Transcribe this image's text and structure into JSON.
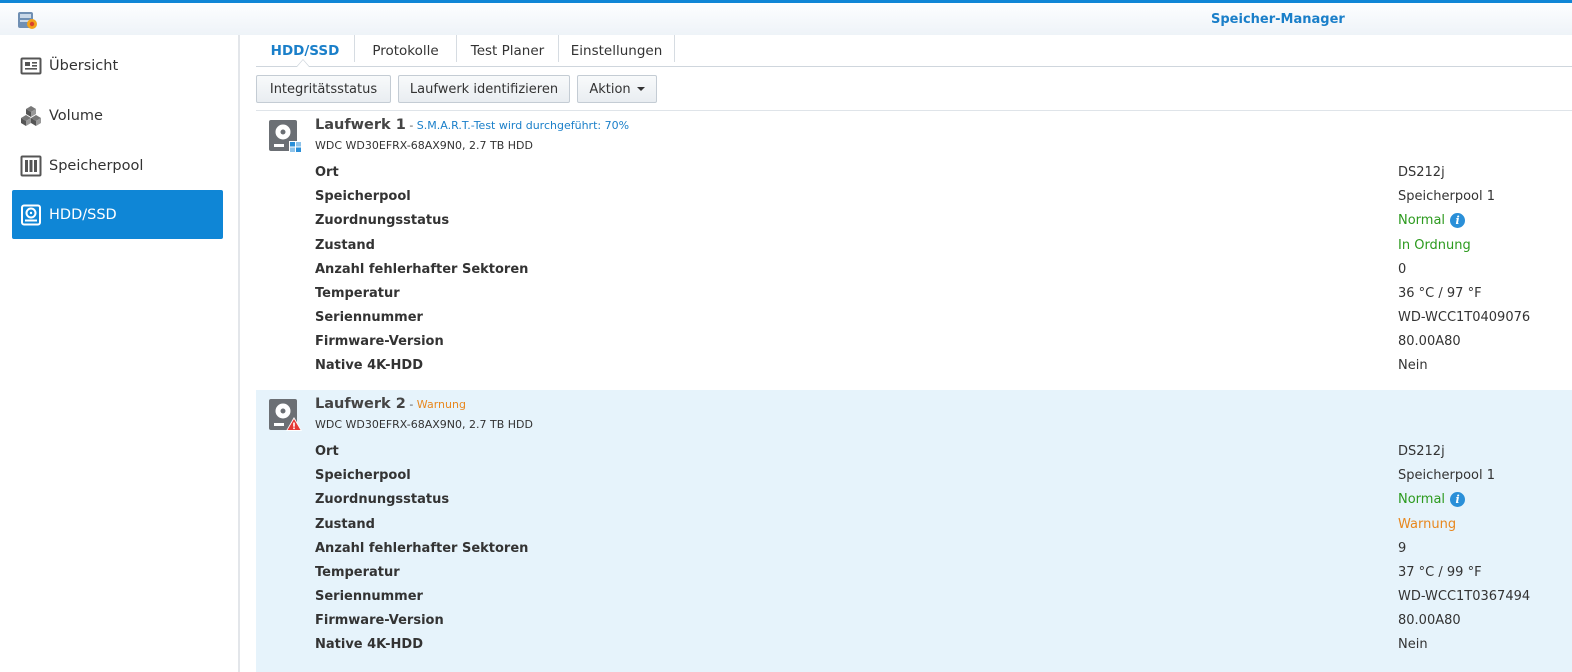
{
  "window": {
    "title": "Speicher-Manager"
  },
  "colors": {
    "accent": "#0f86d6",
    "normal": "#2c9a1e",
    "warning": "#e8871e",
    "smart_status": "#1a7fc9",
    "selected_row": "#e6f3fb"
  },
  "sidebar": {
    "items": [
      {
        "label": "Übersicht",
        "icon": "overview-icon",
        "active": false
      },
      {
        "label": "Volume",
        "icon": "volume-cubes-icon",
        "active": false
      },
      {
        "label": "Speicherpool",
        "icon": "storage-pool-icon",
        "active": false
      },
      {
        "label": "HDD/SSD",
        "icon": "hdd-icon",
        "active": true
      }
    ]
  },
  "tabs": [
    {
      "label": "HDD/SSD",
      "active": true
    },
    {
      "label": "Protokolle",
      "active": false
    },
    {
      "label": "Test Planer",
      "active": false
    },
    {
      "label": "Einstellungen",
      "active": false
    }
  ],
  "toolbar": {
    "health_label": "Integritätsstatus",
    "identify_label": "Laufwerk identifizieren",
    "action_label": "Aktion"
  },
  "field_labels": {
    "location": "Ort",
    "pool": "Speicherpool",
    "allocation": "Zuordnungsstatus",
    "health": "Zustand",
    "bad_sectors": "Anzahl fehlerhafter Sektoren",
    "temperature": "Temperatur",
    "serial": "Seriennummer",
    "firmware": "Firmware-Version",
    "native4k": "Native 4K-HDD"
  },
  "drives": [
    {
      "name": "Laufwerk 1",
      "separator": " - ",
      "status_text": "S.M.A.R.T.-Test wird durchgeführt: 70%",
      "model": "WDC WD30EFRX-68AX9N0, 2.7 TB HDD",
      "icon": "hdd-smart-icon",
      "location": "DS212j",
      "pool": "Speicherpool 1",
      "allocation": "Normal",
      "health": "In Ordnung",
      "bad_sectors": "0",
      "temperature": "36 °C / 97 °F",
      "serial": "WD-WCC1T0409076",
      "firmware": "80.00A80",
      "native4k": "Nein"
    },
    {
      "name": "Laufwerk 2",
      "separator": " - ",
      "status_text": "Warnung",
      "model": "WDC WD30EFRX-68AX9N0, 2.7 TB HDD",
      "icon": "hdd-warning-icon",
      "location": "DS212j",
      "pool": "Speicherpool 1",
      "allocation": "Normal",
      "health": "Warnung",
      "bad_sectors": "9",
      "temperature": "37 °C / 99 °F",
      "serial": "WD-WCC1T0367494",
      "firmware": "80.00A80",
      "native4k": "Nein"
    }
  ]
}
